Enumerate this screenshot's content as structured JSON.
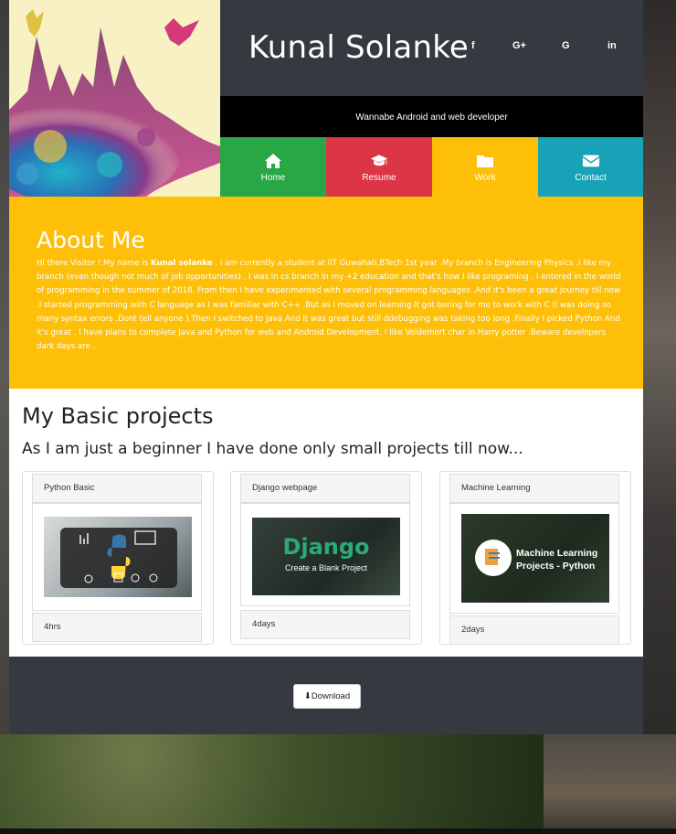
{
  "header": {
    "name": "Kunal Solanke",
    "tagline": "Wannabe Android and web developer",
    "socials": [
      {
        "icon": "facebook-icon",
        "label": "f"
      },
      {
        "icon": "google-plus-icon",
        "label": "G+"
      },
      {
        "icon": "google-icon",
        "label": "G"
      },
      {
        "icon": "linkedin-icon",
        "label": "in"
      }
    ]
  },
  "nav": {
    "tabs": [
      {
        "label": "Home",
        "icon": "home-icon",
        "color": "#28a745"
      },
      {
        "label": "Resume",
        "icon": "graduation-cap-icon",
        "color": "#dc3545"
      },
      {
        "label": "Work",
        "icon": "folder-icon",
        "color": "#fdbf08"
      },
      {
        "label": "Contact",
        "icon": "envelope-icon",
        "color": "#17a2b8"
      }
    ]
  },
  "about": {
    "heading": "About Me",
    "intro": "Hi there Visitor !.My name is ",
    "name_bold": "Kunal solanke",
    "body": " . I am currently a student at IIT Guwahati,BTech 1st year .My branch is Engineering Physics .I like my branch (even though not much of job opportunities) . I was in cs branch In my +2 education and that's how I like programing . I entered in the world of programming in the summer of 2018. From then I have experimented with several programming languages .And it's been a great journey till now .I started programming with C language as I was familiar with C++ .But as I moved on learning It got boring for me to work with C (I was doing so many syntax errors .Dont tell anyone ).Then I switched to Java And It was great but still ddebugging was taking too long .Finally I picked Python And it's great . I have plans to complete Java and Python for web and Android Development. I like Voldemort char in Harry potter .Beware developers dark days are ."
  },
  "projects": {
    "heading": "My Basic projects",
    "subheading": "As I am just a beginner I have done only small projects till now...",
    "items": [
      {
        "title": "Python Basic",
        "duration": "4hrs"
      },
      {
        "title": "Django webpage",
        "duration": "4days",
        "thumb_title": "Django",
        "thumb_sub": "Create a Blank Project"
      },
      {
        "title": "Machine Learning",
        "duration": "2days",
        "thumb_title": "Machine Learning",
        "thumb_sub": "Projects - Python"
      }
    ]
  },
  "footer": {
    "download_label": "Download"
  },
  "colors": {
    "header_bg": "#353a41",
    "about_bg": "#fdbf08",
    "django_green": "#2ba977"
  }
}
